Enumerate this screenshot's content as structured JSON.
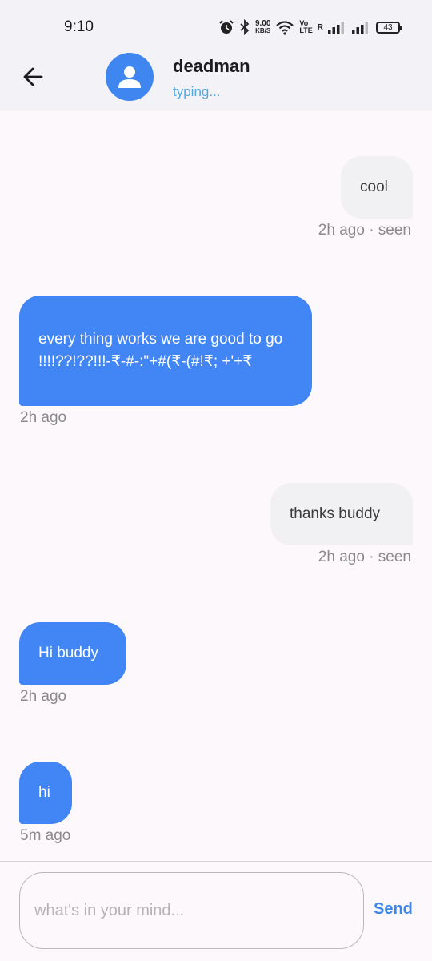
{
  "status_bar": {
    "time": "9:10",
    "speed_value": "9.00",
    "speed_unit": "KB/S",
    "volte_top": "Vo",
    "volte_bottom": "LTE",
    "sim1_label": "R",
    "battery": "43",
    "icons": [
      "alarm-icon",
      "bluetooth-icon",
      "wifi-icon",
      "signal-icon"
    ]
  },
  "header": {
    "contact_name": "deadman",
    "contact_status": "typing...",
    "icons": [
      "back-arrow-icon",
      "person-icon"
    ]
  },
  "messages": [
    {
      "direction": "outgoing",
      "text": "cool",
      "meta": "2h ago · seen"
    },
    {
      "direction": "incoming",
      "text": "every thing works we are good to go !!!!??!??!!!-₹-#-:\"+#(₹-(#!₹; +'+₹",
      "meta": "2h ago"
    },
    {
      "direction": "outgoing",
      "text": "thanks buddy",
      "meta": "2h ago · seen"
    },
    {
      "direction": "incoming",
      "text": "Hi buddy",
      "meta": "2h ago"
    },
    {
      "direction": "incoming",
      "text": "hi",
      "meta": "5m ago"
    }
  ],
  "composer": {
    "placeholder": "what's in your mind...",
    "value": "",
    "send_label": "Send"
  },
  "colors": {
    "accent": "#4285f4",
    "status_text": "#53a8e2",
    "outgoing_bubble": "#f1f1f3",
    "background": "#fdf8fc"
  }
}
